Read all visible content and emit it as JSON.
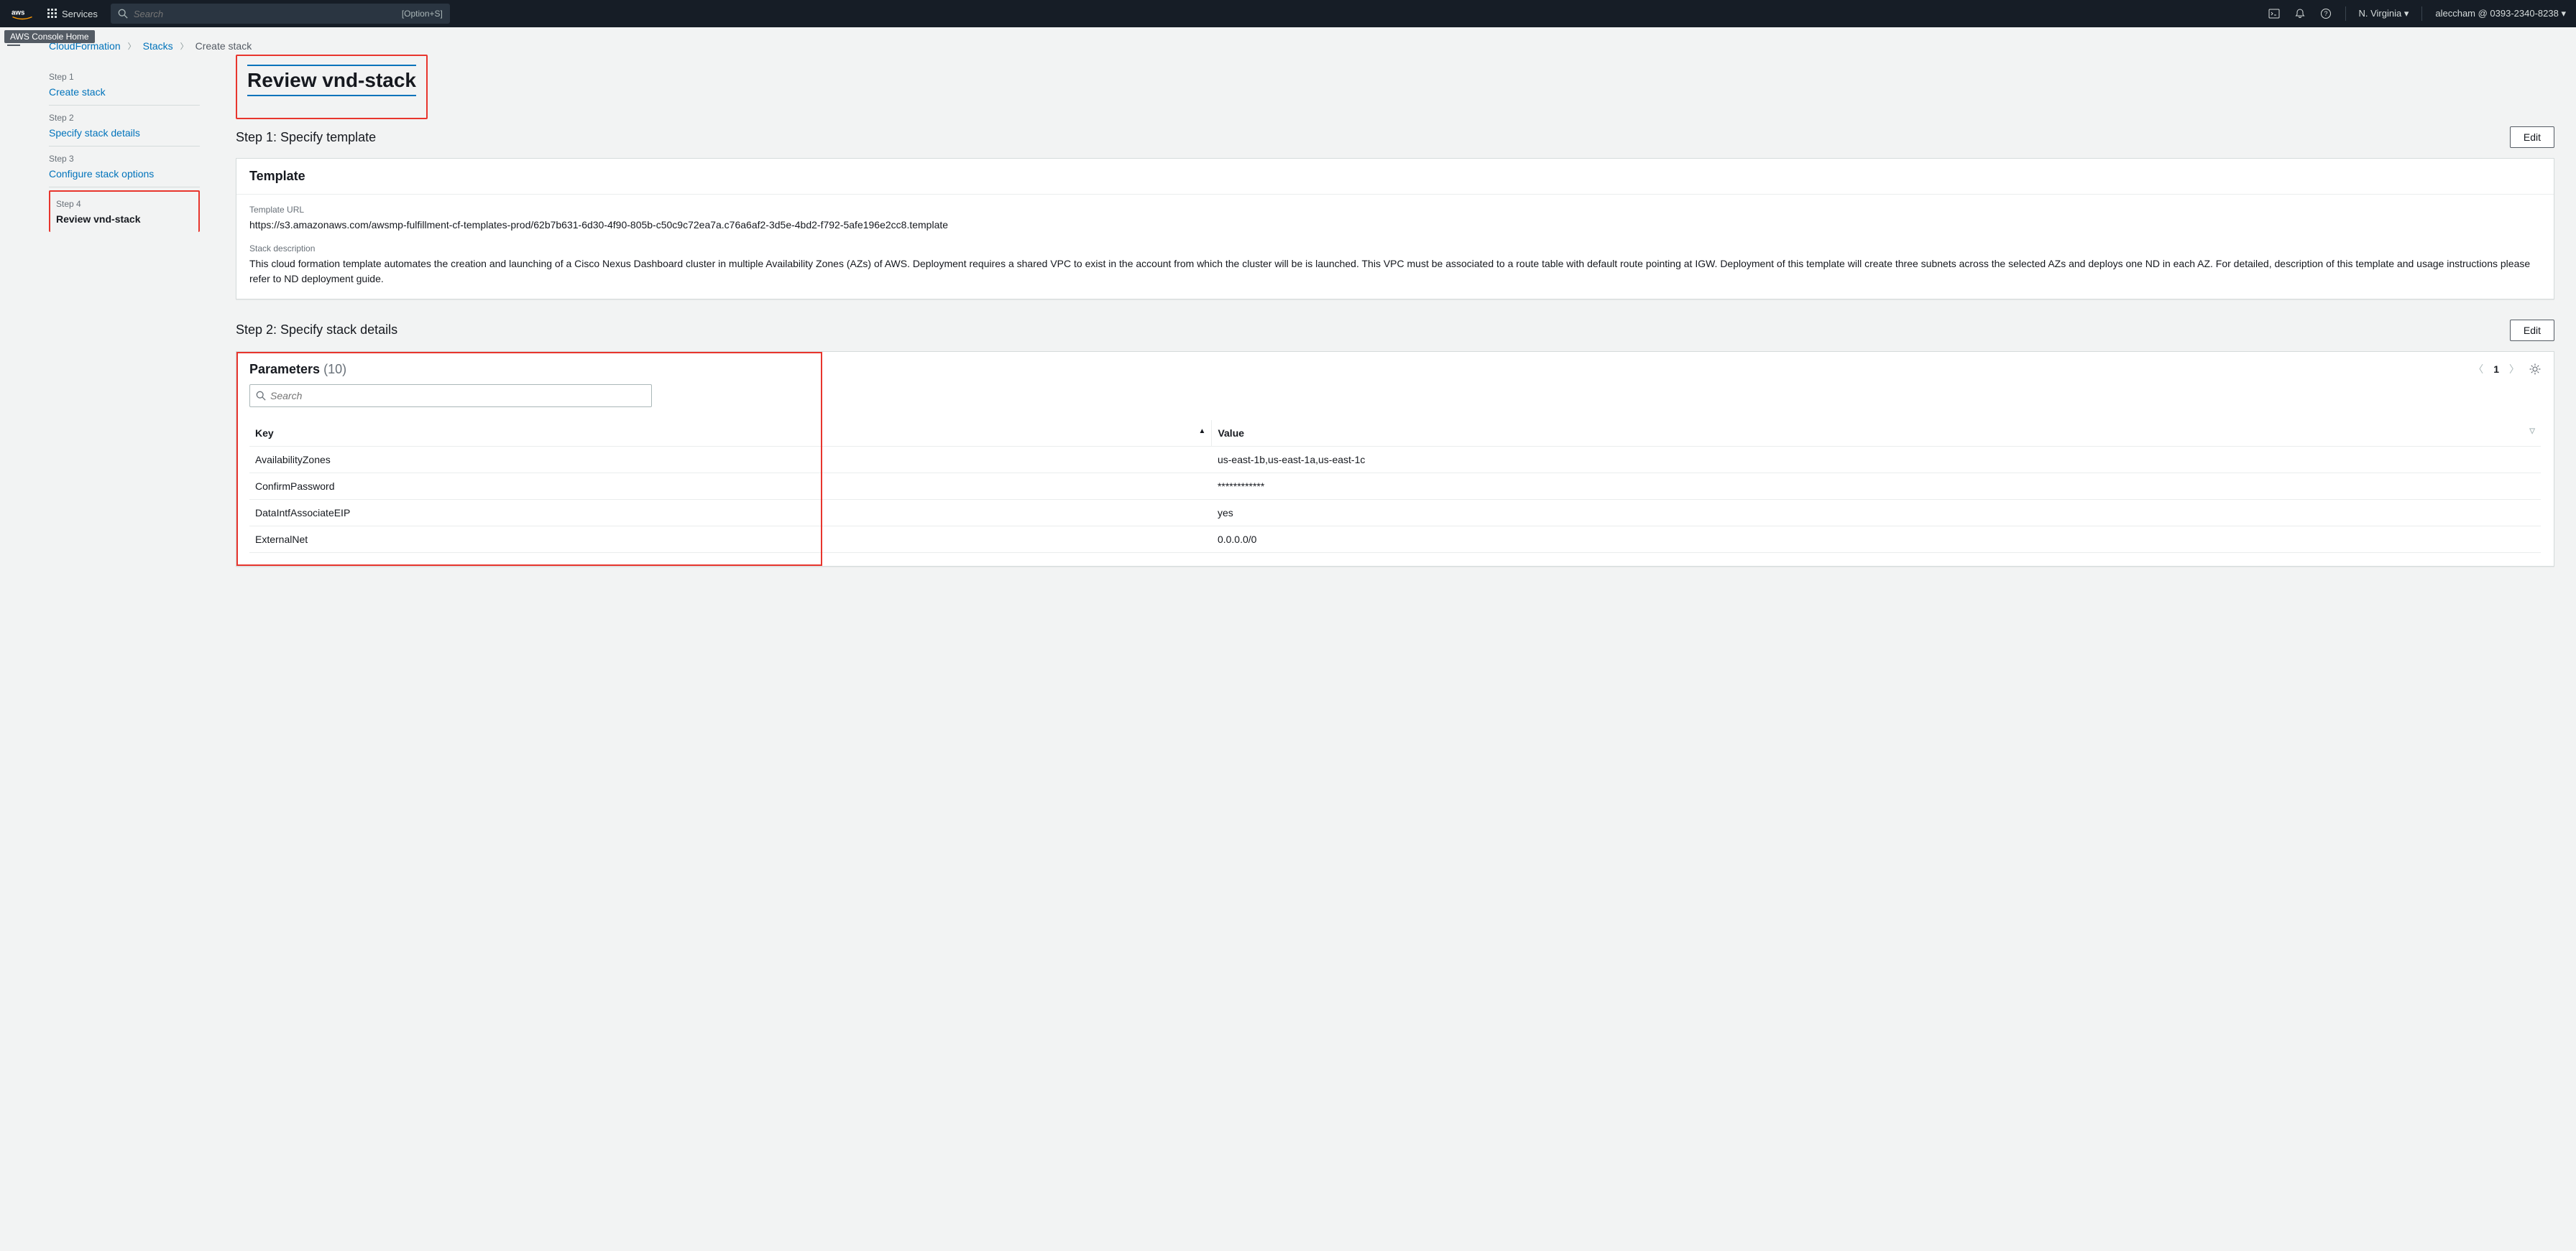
{
  "topnav": {
    "services_label": "Services",
    "search_placeholder": "Search",
    "search_hint": "[Option+S]",
    "region": "N. Virginia",
    "account": "aleccham @ 0393-2340-8238",
    "tooltip": "AWS Console Home"
  },
  "breadcrumbs": {
    "root": "CloudFormation",
    "stacks": "Stacks",
    "current": "Create stack"
  },
  "wizard": {
    "steps": [
      {
        "label": "Step 1",
        "title": "Create stack",
        "link": true
      },
      {
        "label": "Step 2",
        "title": "Specify stack details",
        "link": true
      },
      {
        "label": "Step 3",
        "title": "Configure stack options",
        "link": true
      },
      {
        "label": "Step 4",
        "title": "Review vnd-stack",
        "link": false
      }
    ]
  },
  "page_title": "Review vnd-stack",
  "step1": {
    "heading": "Step 1: Specify template",
    "edit": "Edit",
    "panel_title": "Template",
    "url_label": "Template URL",
    "url_value": "https://s3.amazonaws.com/awsmp-fulfillment-cf-templates-prod/62b7b631-6d30-4f90-805b-c50c9c72ea7a.c76a6af2-3d5e-4bd2-f792-5afe196e2cc8.template",
    "desc_label": "Stack description",
    "desc_value": "This cloud formation template automates the creation and launching of a Cisco Nexus Dashboard cluster in multiple Availability Zones (AZs) of AWS. Deployment requires a shared VPC to exist in the account from which the cluster will be is launched. This VPC must be associated to a route table with default route pointing at IGW. Deployment of this template will create three subnets across the selected AZs and deploys one ND in each AZ. For detailed, description of this template and usage instructions please refer to ND deployment guide."
  },
  "step2": {
    "heading": "Step 2: Specify stack details",
    "edit": "Edit",
    "panel_title": "Parameters",
    "count": "(10)",
    "search_placeholder": "Search",
    "page_num": "1",
    "col_key": "Key",
    "col_value": "Value",
    "rows": [
      {
        "k": "AvailabilityZones",
        "v": "us-east-1b,us-east-1a,us-east-1c"
      },
      {
        "k": "ConfirmPassword",
        "v": "************"
      },
      {
        "k": "DataIntfAssociateEIP",
        "v": "yes"
      },
      {
        "k": "ExternalNet",
        "v": "0.0.0.0/0"
      }
    ]
  }
}
